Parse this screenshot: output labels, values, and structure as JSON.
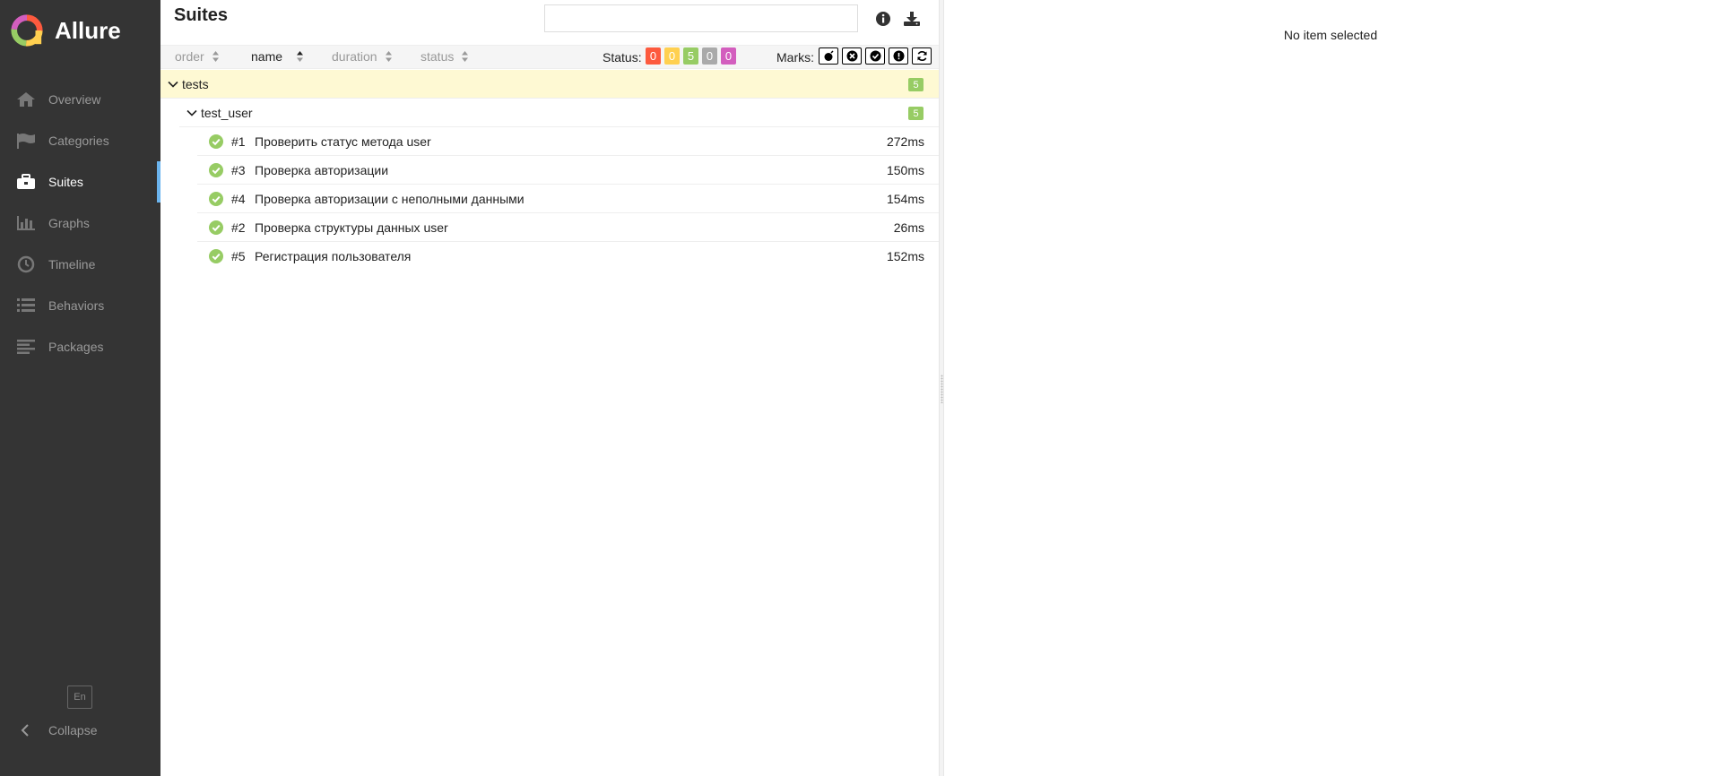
{
  "app": {
    "name": "Allure"
  },
  "sidebar": {
    "items": [
      {
        "label": "Overview",
        "icon": "home-icon"
      },
      {
        "label": "Categories",
        "icon": "flag-icon"
      },
      {
        "label": "Suites",
        "icon": "briefcase-icon",
        "active": true
      },
      {
        "label": "Graphs",
        "icon": "bar-chart-icon"
      },
      {
        "label": "Timeline",
        "icon": "clock-icon"
      },
      {
        "label": "Behaviors",
        "icon": "list-icon"
      },
      {
        "label": "Packages",
        "icon": "align-left-icon"
      }
    ],
    "language": "En",
    "collapse_label": "Collapse"
  },
  "suites_pane": {
    "title": "Suites",
    "search": {
      "value": "",
      "placeholder": ""
    },
    "sorters": [
      {
        "label": "order",
        "active": false
      },
      {
        "label": "name",
        "active": true
      },
      {
        "label": "duration",
        "active": false
      },
      {
        "label": "status",
        "active": false
      }
    ],
    "status_filter": {
      "label": "Status:",
      "badges": [
        {
          "value": "0",
          "color": "#fd5a3e"
        },
        {
          "value": "0",
          "color": "#ffd050"
        },
        {
          "value": "5",
          "color": "#97cc64"
        },
        {
          "value": "0",
          "color": "#aaaaaa"
        },
        {
          "value": "0",
          "color": "#d35ebe"
        }
      ]
    },
    "marks": {
      "label": "Marks:",
      "icons": [
        "bomb-icon",
        "times-circle-icon",
        "check-circle-icon",
        "exclamation-circle-icon",
        "refresh-icon"
      ]
    },
    "tree": {
      "suite": {
        "name": "tests",
        "count": "5"
      },
      "subsuite": {
        "name": "test_user",
        "count": "5"
      },
      "tests": [
        {
          "num": "#1",
          "name": "Проверить статус метода user",
          "duration": "272ms",
          "status": "passed"
        },
        {
          "num": "#3",
          "name": "Проверка авторизации",
          "duration": "150ms",
          "status": "passed"
        },
        {
          "num": "#4",
          "name": "Проверка авторизации с неполными данными",
          "duration": "154ms",
          "status": "passed"
        },
        {
          "num": "#2",
          "name": "Проверка структуры данных user",
          "duration": "26ms",
          "status": "passed"
        },
        {
          "num": "#5",
          "name": "Регистрация пользователя",
          "duration": "152ms",
          "status": "passed"
        }
      ]
    }
  },
  "detail_pane": {
    "empty_message": "No item selected"
  },
  "colors": {
    "sidebar_bg": "#343434",
    "accent": "#6bb4ee",
    "passed": "#97cc64",
    "selected_row": "#fef9d3"
  }
}
